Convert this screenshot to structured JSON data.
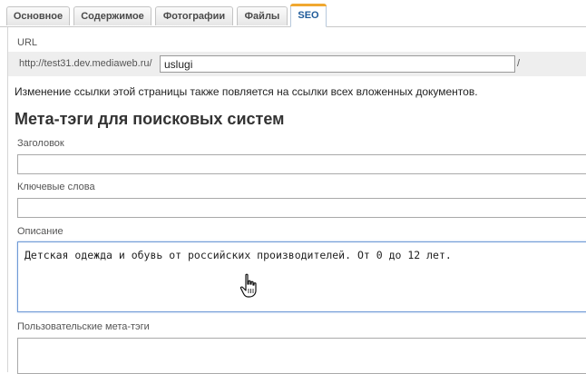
{
  "tabs": [
    {
      "label": "Основное",
      "active": false
    },
    {
      "label": "Содержимое",
      "active": false
    },
    {
      "label": "Фотографии",
      "active": false
    },
    {
      "label": "Файлы",
      "active": false
    },
    {
      "label": "SEO",
      "active": true
    }
  ],
  "url": {
    "label": "URL",
    "prefix": "http://test31.dev.mediaweb.ru/",
    "value": "uslugi",
    "suffix": "/"
  },
  "note": "Изменение ссылки этой страницы также повляется на ссылки всех вложенных документов.",
  "meta_heading": "Мета-тэги для поисковых систем",
  "fields": {
    "title": {
      "label": "Заголовок",
      "value": ""
    },
    "keywords": {
      "label": "Ключевые слова",
      "value": ""
    },
    "description": {
      "label": "Описание",
      "value": "Детская одежда и обувь от российских производителей. От 0 до 12 лет."
    },
    "custom_meta": {
      "label": "Пользовательские мета-тэги",
      "value": ""
    }
  },
  "colors": {
    "active_tab_accent": "#f0a830",
    "active_tab_text": "#1f5b9a",
    "focus_border": "#6f9ad6"
  },
  "icons": {
    "cursor": "hand-pointer-icon"
  }
}
